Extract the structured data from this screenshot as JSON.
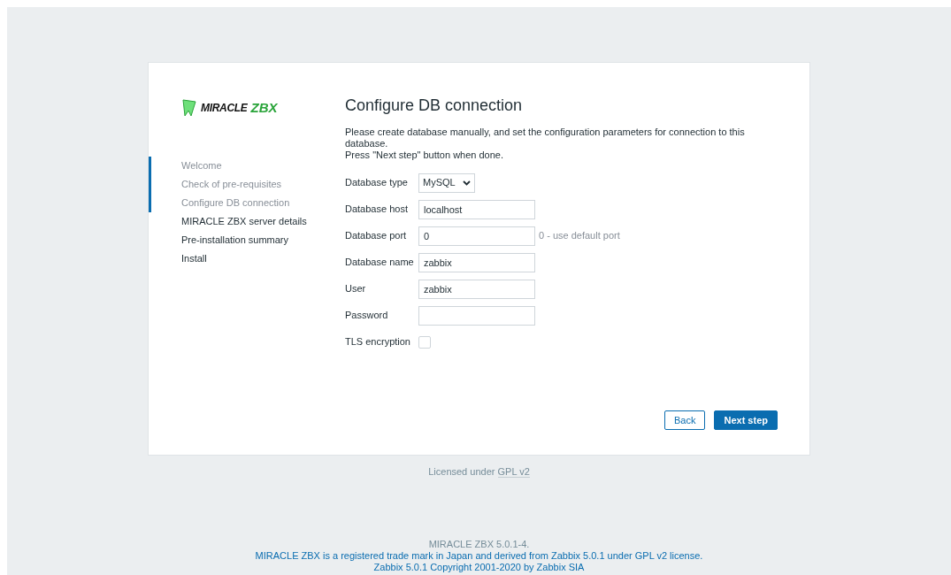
{
  "logo": {
    "part_1": "MIRACLE",
    "part_2": "ZBX"
  },
  "steps": [
    {
      "label": "Welcome",
      "done": true
    },
    {
      "label": "Check of pre-requisites",
      "done": true
    },
    {
      "label": "Configure DB connection",
      "done": true
    },
    {
      "label": "MIRACLE ZBX server details",
      "done": false
    },
    {
      "label": "Pre-installation summary",
      "done": false
    },
    {
      "label": "Install",
      "done": false
    }
  ],
  "title": "Configure DB connection",
  "intro": [
    "Please create database manually, and set the configuration parameters for connection to this database.",
    "Press \"Next step\" button when done."
  ],
  "fields": [
    {
      "kind": "select",
      "label": "Database type",
      "value": "MySQL"
    },
    {
      "kind": "text",
      "label": "Database host",
      "value": "localhost"
    },
    {
      "kind": "text",
      "label": "Database port",
      "value": "0",
      "hint": "0 - use default port"
    },
    {
      "kind": "text",
      "label": "Database name",
      "value": "zabbix"
    },
    {
      "kind": "text",
      "label": "User",
      "value": "zabbix"
    },
    {
      "kind": "password",
      "label": "Password"
    },
    {
      "kind": "checkbox",
      "label": "TLS encryption",
      "checked": false
    }
  ],
  "buttons": {
    "back": "Back",
    "next": "Next step"
  },
  "license": {
    "text": "Licensed under",
    "link": "GPL v2"
  },
  "footer": {
    "version": "MIRACLE ZBX 5.0.1-4.",
    "lines": [
      "MIRACLE ZBX is a registered trade mark in Japan and derived from Zabbix 5.0.1 under GPL v2 license.",
      "Zabbix 5.0.1 Copyright 2001-2020 by Zabbix SIA"
    ]
  }
}
